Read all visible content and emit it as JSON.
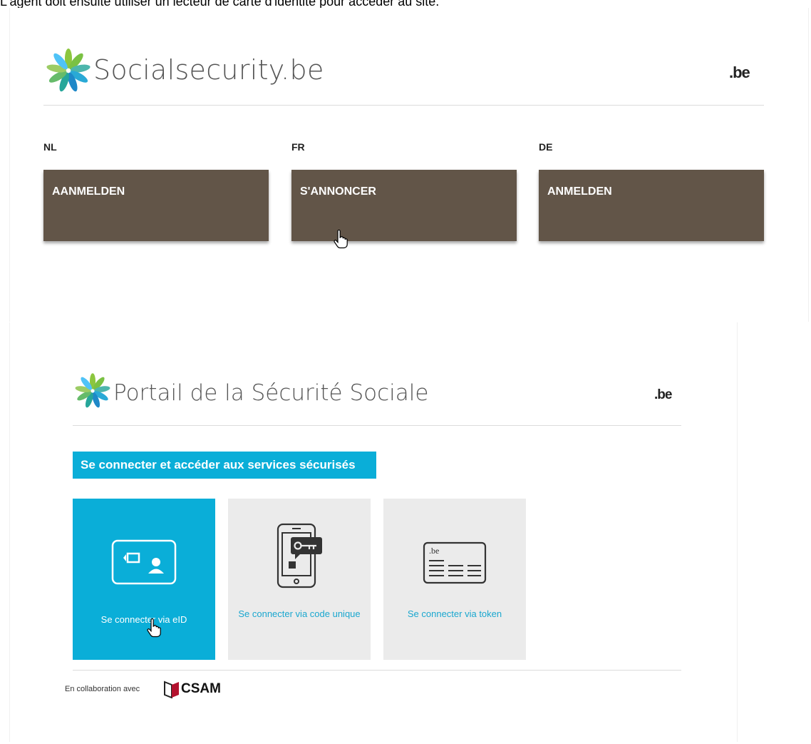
{
  "intro_text": "L'agent doit ensuite utiliser un lecteur de carte d'identité pour accéder au site.",
  "panel1": {
    "site_title": "Socialsecurity.be",
    "domain_suffix": ".be",
    "languages": [
      {
        "code": "NL",
        "button_label": "AANMELDEN"
      },
      {
        "code": "FR",
        "button_label": "S'ANNONCER"
      },
      {
        "code": "DE",
        "button_label": "ANMELDEN"
      }
    ],
    "button_color": "#625548"
  },
  "panel2": {
    "site_title": "Portail de la Sécurité Sociale",
    "domain_suffix": ".be",
    "section_heading": "Se connecter et accéder aux services sécurisés",
    "accent_color": "#0aaed8",
    "login_options": [
      {
        "label": "Se connecter via eID",
        "icon": "eid-card-icon",
        "active": true
      },
      {
        "label": "Se connecter via code unique",
        "icon": "smartphone-key-icon",
        "active": false
      },
      {
        "label": "Se connecter via token",
        "icon": "token-card-icon",
        "active": false
      }
    ],
    "collaboration_text": "En collaboration avec",
    "partner_name": "CSAM"
  }
}
